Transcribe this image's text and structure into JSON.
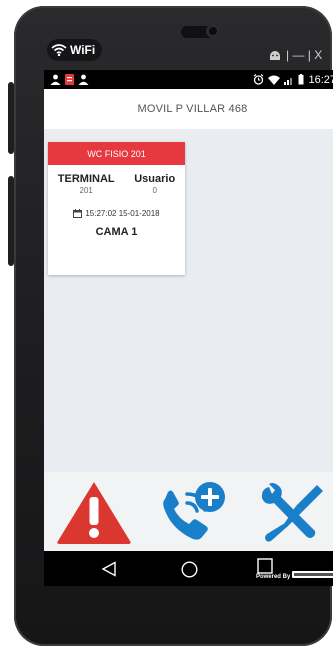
{
  "device": {
    "wifi_label": "WiFi",
    "window_controls": "| — |  X"
  },
  "statusbar": {
    "time": "16:27"
  },
  "app": {
    "title": "MOVIL P VILLAR 468"
  },
  "card": {
    "header": "WC FISIO 201",
    "terminal_label": "TERMINAL",
    "terminal_value": "201",
    "usuario_label": "Usuario",
    "usuario_value": "0",
    "datetime": "15:27:02 15-01-2018",
    "bed": "CAMA 1",
    "header_color": "#e5393f"
  },
  "actions": {
    "alert_icon": "warning-triangle-icon",
    "call_icon": "phone-add-icon",
    "settings_icon": "wrench-screwdriver-icon",
    "alert_color": "#d9372f",
    "call_color": "#1a7fc9",
    "settings_color": "#1a7fc9"
  },
  "navbar": {
    "powered_by": "Powered By"
  }
}
